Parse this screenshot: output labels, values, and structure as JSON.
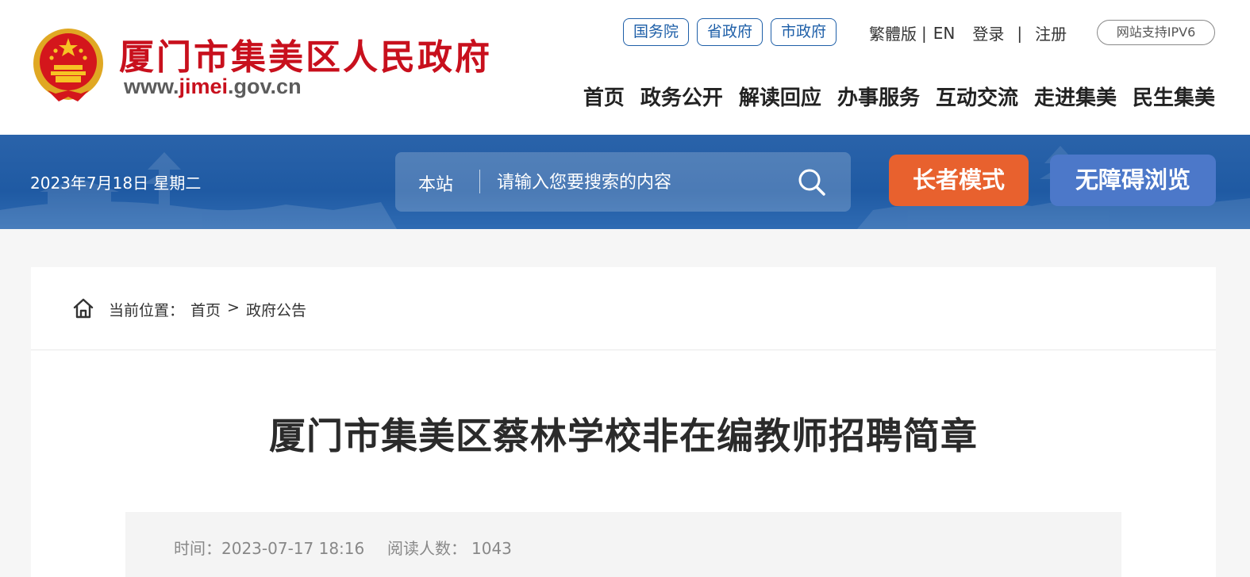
{
  "header": {
    "site_name": "厦门市集美区人民政府",
    "url_prefix": "www.",
    "url_accent": "jimei",
    "url_suffix": ".gov.cn",
    "gov_links": [
      "国务院",
      "省政府",
      "市政府"
    ],
    "traditional": "繁體版",
    "english": "EN",
    "login": "登录",
    "register": "注册",
    "separator": "|",
    "ipv6": "网站支持IPV6",
    "nav": [
      "首页",
      "政务公开",
      "解读回应",
      "办事服务",
      "互动交流",
      "走进集美",
      "民生集美"
    ]
  },
  "banner": {
    "date": "2023年7月18日 星期二",
    "search_scope": "本站",
    "search_placeholder": "请输入您要搜索的内容",
    "elder_mode": "长者模式",
    "accessibility": "无障碍浏览"
  },
  "breadcrumb": {
    "label": "当前位置：",
    "home": "首页",
    "arrow": ">",
    "current": "政府公告"
  },
  "article": {
    "title": "厦门市集美区蔡林学校非在编教师招聘简章",
    "time_label": "时间：",
    "time_value": "2023-07-17 18:16",
    "views_label": "阅读人数：",
    "views_value": "1043"
  },
  "colors": {
    "brand_red": "#c8101d",
    "link_blue": "#1e5fa8",
    "banner_blue": "#2a63aa",
    "elder_orange": "#e8612e",
    "access_blue": "#4c78c9"
  }
}
